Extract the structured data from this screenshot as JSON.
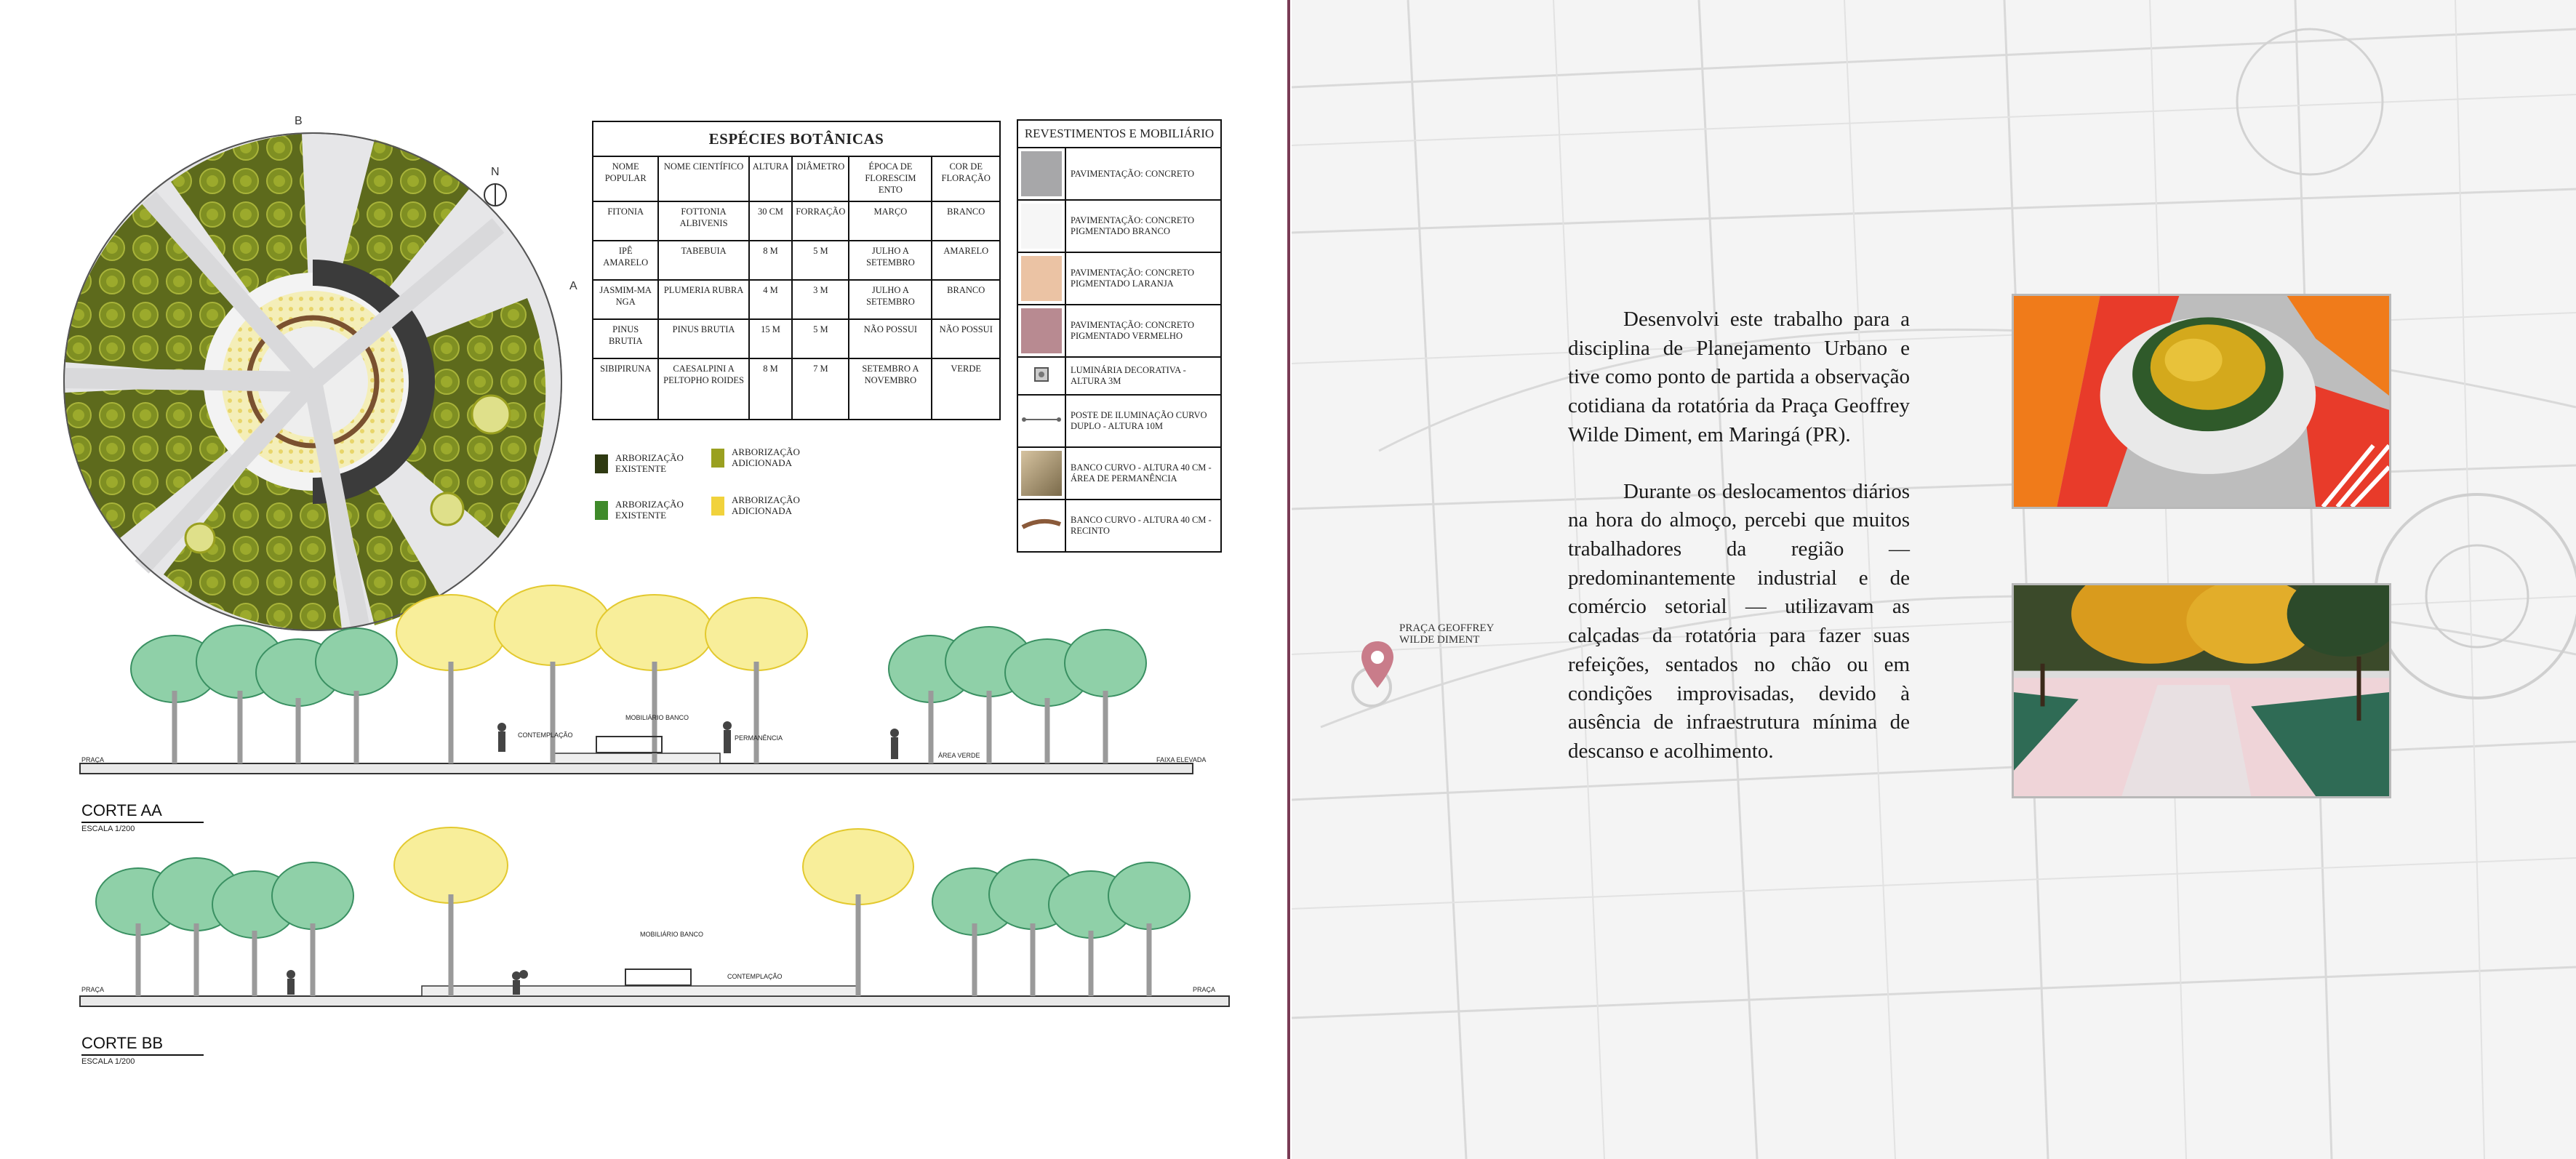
{
  "plan": {
    "north": "N",
    "label_a": "A",
    "label_b": "B"
  },
  "species_table": {
    "title": "ESPÉCIES BOTÂNICAS",
    "headers": [
      "NOME POPULAR",
      "NOME CIENTÍFICO",
      "ALTURA",
      "DIÂMETRO",
      "ÉPOCA DE FLORESCIM ENTO",
      "COR DE FLORAÇÃO"
    ],
    "rows": [
      [
        "FITONIA",
        "FOTTONIA ALBIVENIS",
        "30 CM",
        "FORRAÇÃO",
        "MARÇO",
        "BRANCO"
      ],
      [
        "IPÊ AMARELO",
        "TABEBUIA",
        "8 M",
        "5 M",
        "JULHO A SETEMBRO",
        "AMARELO"
      ],
      [
        "JASMIM-MA NGA",
        "PLUMERIA RUBRA",
        "4 M",
        "3 M",
        "JULHO A SETEMBRO",
        "BRANCO"
      ],
      [
        "PINUS BRUTIA",
        "PINUS BRUTIA",
        "15 M",
        "5 M",
        "NÃO POSSUI",
        "NÃO POSSUI"
      ],
      [
        "SIBIPIRUNA",
        "CAESALPINI A PELTOPHO ROIDES",
        "8 M",
        "7 M",
        "SETEMBRO A NOVEMBRO",
        "VERDE"
      ]
    ]
  },
  "legend": [
    {
      "label": "ARBORIZAÇÃO EXISTENTE",
      "color": "#2f3a12"
    },
    {
      "label": "ARBORIZAÇÃO ADICIONADA",
      "color": "#9aa020"
    },
    {
      "label": "ARBORIZAÇÃO EXISTENTE",
      "color": "#3f8a2a"
    },
    {
      "label": "ARBORIZAÇÃO ADICIONADA",
      "color": "#f1d23c"
    }
  ],
  "materials_table": {
    "title": "REVESTIMENTOS E MOBILIÁRIO",
    "rows": [
      {
        "label": "PAVIMENTAÇÃO: CONCRETO",
        "color": "#a7a7a9"
      },
      {
        "label": "PAVIMENTAÇÃO: CONCRETO PIGMENTADO BRANCO",
        "color": "#f6f6f6"
      },
      {
        "label": "PAVIMENTAÇÃO: CONCRETO PIGMENTADO LARANJA",
        "color": "#ebc3a4"
      },
      {
        "label": "PAVIMENTAÇÃO: CONCRETO PIGMENTADO VERMELHO",
        "color": "#b88a91"
      },
      {
        "label": "LUMINÁRIA DECORATIVA - ALTURA 3M",
        "color": "#bdbdbd"
      },
      {
        "label": "POSTE DE ILUMINAÇÃO CURVO DUPLO - ALTURA 10M",
        "color": "#9a9a9a"
      },
      {
        "label": "BANCO CURVO - ALTURA 40 CM - ÁREA DE PERMANÊNCIA",
        "color": "#8a7a5a"
      },
      {
        "label": "BANCO CURVO - ALTURA 40 CM - RECINTO",
        "color": "#8a5a3a"
      }
    ]
  },
  "sections": [
    {
      "title": "CORTE AA",
      "scale": "ESCALA 1/200",
      "tag_center": "MOBILIÁRIO BANCO",
      "tag_left": "PRAÇA",
      "tag_right": "FAIXA ELEVADA",
      "tag_mid": "CONTEMPLAÇÃO",
      "tag_mid2": "PERMANÊNCIA",
      "tag_green": "ÁREA VERDE"
    },
    {
      "title": "CORTE BB",
      "scale": "ESCALA 1/200",
      "tag_center": "MOBILIÁRIO BANCO",
      "tag_left": "PRAÇA",
      "tag_right": "PRAÇA",
      "tag_mid": "CONTEMPLAÇÃO"
    }
  ],
  "right_page": {
    "paragraph1": "Desenvolvi este trabalho para a disciplina de Planejamento Urbano e tive como ponto de partida a observação cotidiana da rotatória da Praça Geoffrey Wilde Diment, em Maringá (PR).",
    "paragraph2": "Durante os deslocamentos diários na hora do almoço, percebi que muitos trabalhadores da região — predominantemente industrial e de comércio setorial — utilizavam as calçadas da rotatória para fazer suas refeições, sentados no chão ou em condições improvisadas, devido à ausência de infraestrutura mínima de descanso e acolhimento.",
    "pin_label": "PRAÇA GEOFFREY WILDE DIMENT",
    "pin_color": "#c97c8a"
  }
}
